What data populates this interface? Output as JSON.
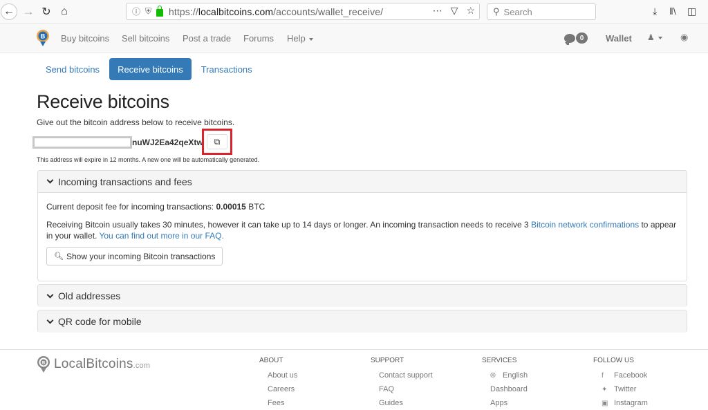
{
  "browser": {
    "url_scheme": "https://",
    "url_host": "localbitcoins.com",
    "url_path": "/accounts/wallet_receive/",
    "search_placeholder": "Search",
    "icons": [
      "back-icon",
      "forward-icon",
      "reload-icon",
      "home-icon",
      "info-icon",
      "tracking-shield-icon",
      "lock-icon",
      "more-icon",
      "pocket-icon",
      "bookmark-star-icon",
      "search-icon",
      "download-icon",
      "library-icon",
      "sidebar-icon"
    ]
  },
  "nav": {
    "items": [
      {
        "label": "Buy bitcoins"
      },
      {
        "label": "Sell bitcoins"
      },
      {
        "label": "Post a trade"
      },
      {
        "label": "Forums"
      },
      {
        "label": "Help"
      }
    ],
    "chat_count": "0",
    "wallet_label": "Wallet"
  },
  "tabs": [
    {
      "label": "Send bitcoins",
      "active": false
    },
    {
      "label": "Receive bitcoins",
      "active": true
    },
    {
      "label": "Transactions",
      "active": false
    }
  ],
  "page": {
    "title": "Receive bitcoins",
    "intro": "Give out the bitcoin address below to receive bitcoins.",
    "address_visible": "nuWJ2Ea42qeXtw",
    "expire_note": "This address will expire in 12 months. A new one will be automatically generated."
  },
  "panels": {
    "incoming": {
      "title": "Incoming transactions and fees",
      "fee_label": "Current deposit fee for incoming transactions: ",
      "fee_value": "0.00015",
      "fee_unit": " BTC",
      "text1": "Receiving Bitcoin usually takes 30 minutes, however it can take up to 14 days or longer. An incoming transaction needs to receive 3 ",
      "link1": "Bitcoin network confirmations",
      "text2": " to appear in your wallet. ",
      "link2": "You can find out more in our FAQ.",
      "button": "Show your incoming Bitcoin transactions"
    },
    "old": {
      "title": "Old addresses"
    },
    "qr": {
      "title": "QR code for mobile"
    }
  },
  "footer": {
    "logo_text": "LocalBitcoins",
    "logo_suffix": ".com",
    "columns": [
      {
        "heading": "ABOUT",
        "items": [
          "About us",
          "Careers",
          "Fees"
        ]
      },
      {
        "heading": "SUPPORT",
        "items": [
          "Contact support",
          "FAQ",
          "Guides"
        ]
      },
      {
        "heading": "SERVICES",
        "items": [
          "English",
          "Dashboard",
          "Apps"
        ]
      },
      {
        "heading": "FOLLOW US",
        "items": [
          "Facebook",
          "Twitter",
          "Instagram"
        ]
      }
    ]
  },
  "colors": {
    "primary": "#337ab7",
    "highlight": "#d9232d",
    "lock": "#12bc00"
  }
}
